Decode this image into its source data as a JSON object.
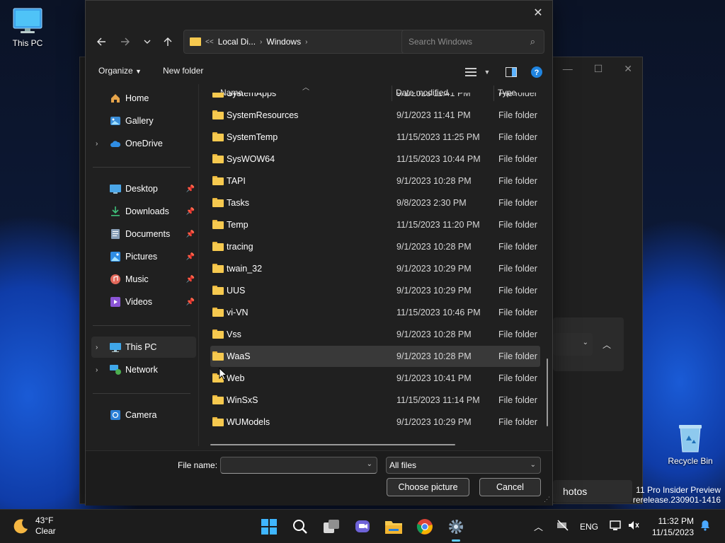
{
  "desktop": {
    "this_pc_label": "This PC",
    "recycle_bin_label": "Recycle Bin",
    "watermark_line1": "11 Pro Insider Preview",
    "watermark_line2": "rerelease.230901-1416",
    "bg_button_label": "hotos"
  },
  "dialog": {
    "address": {
      "overflow": "<<",
      "crumbs": [
        "Local Di...",
        "Windows"
      ]
    },
    "search_placeholder": "Search Windows",
    "toolbar": {
      "organize": "Organize",
      "new_folder": "New folder"
    },
    "sidebar": {
      "items": [
        {
          "label": "Home",
          "icon": "home-icon"
        },
        {
          "label": "Gallery",
          "icon": "gallery-icon"
        },
        {
          "label": "OneDrive",
          "icon": "cloud-icon"
        },
        {
          "label": "Desktop",
          "icon": "desktop-icon"
        },
        {
          "label": "Downloads",
          "icon": "download-icon"
        },
        {
          "label": "Documents",
          "icon": "document-icon"
        },
        {
          "label": "Pictures",
          "icon": "pictures-icon"
        },
        {
          "label": "Music",
          "icon": "music-icon"
        },
        {
          "label": "Videos",
          "icon": "videos-icon"
        },
        {
          "label": "This PC",
          "icon": "monitor-icon"
        },
        {
          "label": "Network",
          "icon": "network-icon"
        },
        {
          "label": "Camera",
          "icon": "camera-icon"
        }
      ]
    },
    "columns": {
      "name": "Name",
      "date": "Date modified",
      "type": "Type"
    },
    "files": [
      {
        "name": "SystemApps",
        "date": "9/1/2023 11:41 PM",
        "type": "File folder"
      },
      {
        "name": "SystemResources",
        "date": "9/1/2023 11:41 PM",
        "type": "File folder"
      },
      {
        "name": "SystemTemp",
        "date": "11/15/2023 11:25 PM",
        "type": "File folder"
      },
      {
        "name": "SysWOW64",
        "date": "11/15/2023 10:44 PM",
        "type": "File folder"
      },
      {
        "name": "TAPI",
        "date": "9/1/2023 10:28 PM",
        "type": "File folder"
      },
      {
        "name": "Tasks",
        "date": "9/8/2023 2:30 PM",
        "type": "File folder"
      },
      {
        "name": "Temp",
        "date": "11/15/2023 11:20 PM",
        "type": "File folder"
      },
      {
        "name": "tracing",
        "date": "9/1/2023 10:28 PM",
        "type": "File folder"
      },
      {
        "name": "twain_32",
        "date": "9/1/2023 10:29 PM",
        "type": "File folder"
      },
      {
        "name": "UUS",
        "date": "9/1/2023 10:29 PM",
        "type": "File folder"
      },
      {
        "name": "vi-VN",
        "date": "11/15/2023 10:46 PM",
        "type": "File folder"
      },
      {
        "name": "Vss",
        "date": "9/1/2023 10:28 PM",
        "type": "File folder"
      },
      {
        "name": "WaaS",
        "date": "9/1/2023 10:28 PM",
        "type": "File folder"
      },
      {
        "name": "Web",
        "date": "9/1/2023 10:41 PM",
        "type": "File folder"
      },
      {
        "name": "WinSxS",
        "date": "11/15/2023 11:14 PM",
        "type": "File folder"
      },
      {
        "name": "WUModels",
        "date": "9/1/2023 10:29 PM",
        "type": "File folder"
      }
    ],
    "footer": {
      "file_name_label": "File name:",
      "file_name_value": "",
      "filter": "All files",
      "choose": "Choose picture",
      "cancel": "Cancel"
    }
  },
  "taskbar": {
    "weather_temp": "43°F",
    "weather_desc": "Clear",
    "lang": "ENG",
    "time": "11:32 PM",
    "date": "11/15/2023"
  },
  "colors": {
    "accent": "#60cdff",
    "folder": "#f6c94f",
    "dialog_bg": "#202020"
  }
}
